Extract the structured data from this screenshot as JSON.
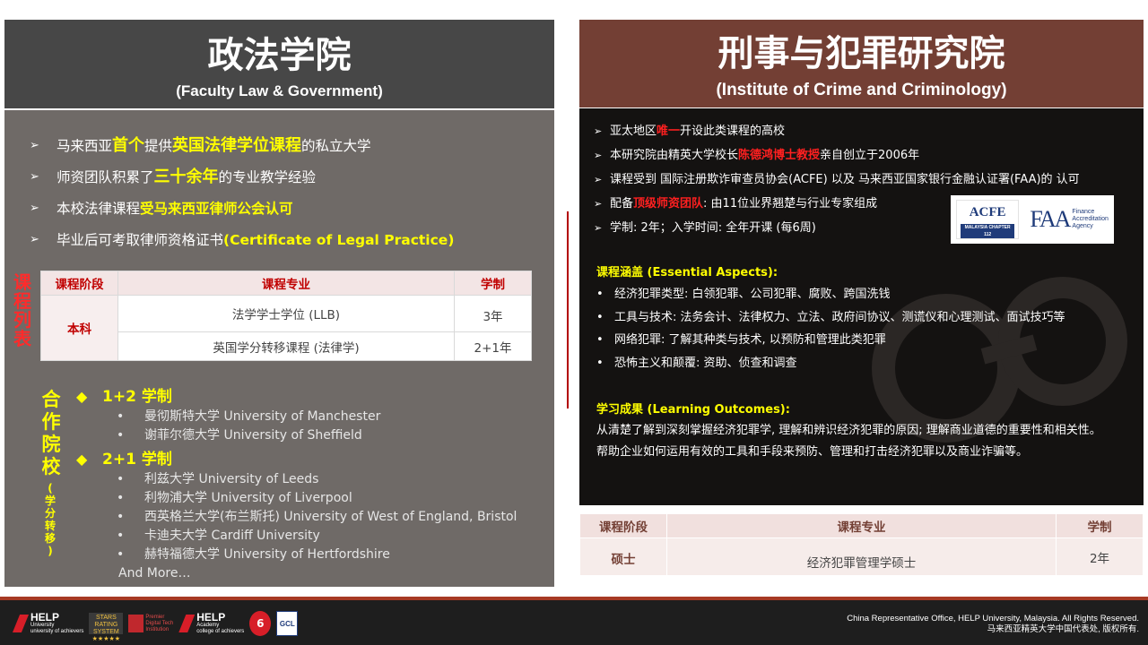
{
  "left": {
    "title_cn": "政法学院",
    "title_en": "(Faculty Law & Government)",
    "points": [
      {
        "pre": "马来西亚",
        "hl1": "首个",
        "mid": "提供",
        "hl2": "英国法律学位课程",
        "post": "的私立大学"
      },
      {
        "pre": "师资团队积累了",
        "hl": "三十余年",
        "post": "的专业教学经验"
      },
      {
        "pre": "本校法律课程",
        "hl": "受马来西亚律师公会认可"
      },
      {
        "pre": "毕业后可考取律师资格证书 ",
        "hl": "(Certificate of Legal Practice)"
      }
    ],
    "course_list_title": [
      "课",
      "程",
      "列",
      "表"
    ],
    "table": {
      "headers": [
        "课程阶段",
        "课程专业",
        "学制"
      ],
      "stage": "本科",
      "rows": [
        {
          "program": "法学学士学位 (LLB)",
          "duration": "3年"
        },
        {
          "program": "英国学分转移课程 (法律学)",
          "duration": "2+1年"
        }
      ]
    },
    "partner_title": [
      "合",
      "作",
      "院",
      "校"
    ],
    "partner_sub": [
      "(",
      "学",
      "分",
      "转",
      "移",
      ")"
    ],
    "groups": [
      {
        "label": "1+2 学制",
        "items": [
          "曼彻斯特大学 University of Manchester",
          "谢菲尔德大学 University of Sheffield"
        ]
      },
      {
        "label": "2+1 学制",
        "items": [
          "利兹大学 University of Leeds",
          "利物浦大学 University of Liverpool",
          "西英格兰大学(布兰斯托) University of West of England, Bristol",
          "卡迪夫大学 Cardiff University",
          "赫特福德大学 University of Hertfordshire"
        ]
      }
    ],
    "more": "And More…"
  },
  "right": {
    "title_cn": "刑事与犯罪研究院",
    "title_en": "(Institute of Crime and Criminology)",
    "p1_pre": "亚太地区",
    "p1_hl": "唯一",
    "p1_post": "开设此类课程的高校",
    "p2_pre": "本研究院由精英大学校长 ",
    "p2_hl": "陈德鸿博士教授",
    "p2_post": " 亲自创立于2006年",
    "p3": "课程受到 国际注册欺诈审查员协会(ACFE) 以及 马来西亚国家银行金融认证署(FAA)的 认可",
    "p4_pre": "配备",
    "p4_hl": "顶级师资团队",
    "p4_post": ": 由11位业界翘楚与行业专家组成",
    "p5": "学制: 2年；入学时间: 全年开课 (每6周)",
    "logo_acfe": "ACFE",
    "logo_acfe_sub": "MALAYSIA CHAPTER 112",
    "logo_faa": "FAA",
    "logo_faa_text": [
      "Finance",
      "Accreditation",
      "Agency"
    ],
    "aspects_title": "课程涵盖 (Essential Aspects):",
    "aspects": [
      "经济犯罪类型:  白领犯罪、公司犯罪、腐败、跨国洗钱",
      "工具与技术:  法务会计、法律权力、立法、政府间协议、测谎仪和心理测试、面试技巧等",
      "网络犯罪:  了解其种类与技术, 以预防和管理此类犯罪",
      "恐怖主义和颠覆:  资助、侦查和调查"
    ],
    "outcomes_title": "学习成果 (Learning Outcomes):",
    "outcomes": [
      "从清楚了解到深刻掌握经济犯罪学, 理解和辨识经济犯罪的原因; 理解商业道德的重要性和相关性。",
      "帮助企业如何运用有效的工具和手段来预防、管理和打击经济犯罪以及商业诈骗等。"
    ],
    "table": {
      "headers": [
        "课程阶段",
        "课程专业",
        "学制"
      ],
      "stage": "硕士",
      "program": "经济犯罪管理学硕士",
      "duration": "2年"
    }
  },
  "footer": {
    "help_university": {
      "name": "HELP",
      "sub1": "University",
      "sub2": "university of achievers"
    },
    "stars": {
      "line1": "STARS",
      "line2": "RATING SYSTEM",
      "line3": "★★★★★"
    },
    "digital": {
      "line1": "Premier",
      "line2": "Digital Tech",
      "line3": "Institution"
    },
    "help_academy": {
      "name": "HELP",
      "sub1": "Academy",
      "sub2": "college of achievers"
    },
    "badge": "6",
    "gcl": "GCL",
    "copyright_en": "China Representative Office, HELP University, Malaysia. All Rights Reserved.",
    "copyright_cn": "马来西亚精英大学中国代表处, 版权所有."
  }
}
